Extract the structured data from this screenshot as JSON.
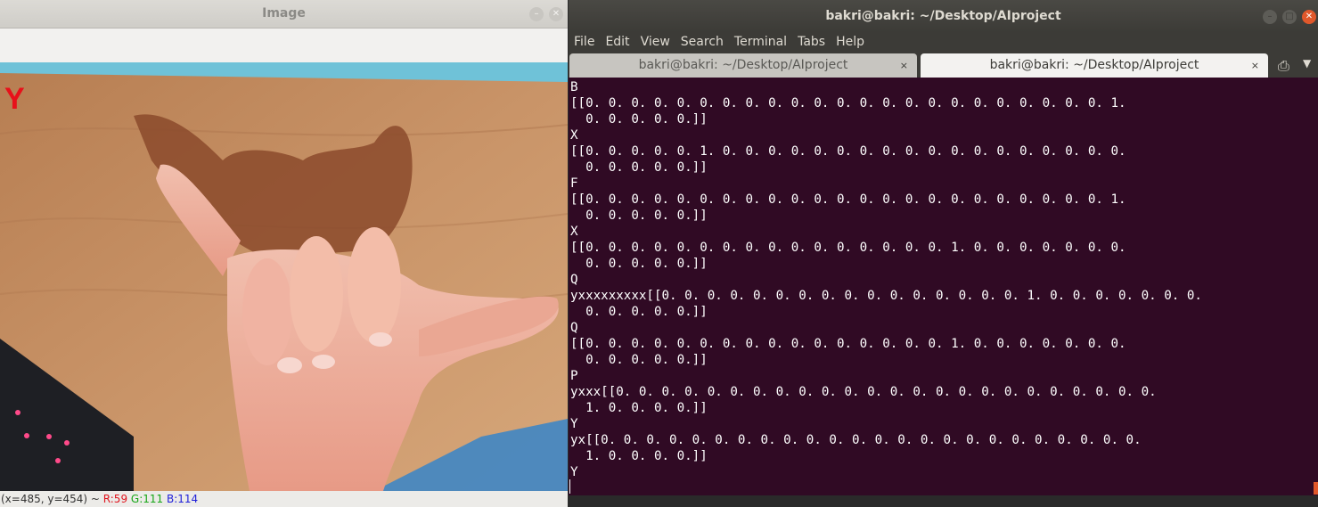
{
  "image_window": {
    "title": "Image",
    "overlay_letter": "Y",
    "status": {
      "coords": "(x=485, y=454) ~ ",
      "r": "R:59",
      "g": "G:111",
      "b": "B:114"
    }
  },
  "terminal_window": {
    "title": "bakri@bakri: ~/Desktop/AIproject",
    "menu": [
      "File",
      "Edit",
      "View",
      "Search",
      "Terminal",
      "Tabs",
      "Help"
    ],
    "tabs": [
      {
        "label": "bakri@bakri: ~/Desktop/AIproject",
        "close": "×"
      },
      {
        "label": "bakri@bakri: ~/Desktop/AIproject",
        "close": "×"
      }
    ],
    "output_lines": [
      "B",
      "[[0. 0. 0. 0. 0. 0. 0. 0. 0. 0. 0. 0. 0. 0. 0. 0. 0. 0. 0. 0. 0. 0. 0. 1.",
      "  0. 0. 0. 0. 0.]]",
      "X",
      "[[0. 0. 0. 0. 0. 1. 0. 0. 0. 0. 0. 0. 0. 0. 0. 0. 0. 0. 0. 0. 0. 0. 0. 0.",
      "  0. 0. 0. 0. 0.]]",
      "F",
      "[[0. 0. 0. 0. 0. 0. 0. 0. 0. 0. 0. 0. 0. 0. 0. 0. 0. 0. 0. 0. 0. 0. 0. 1.",
      "  0. 0. 0. 0. 0.]]",
      "X",
      "[[0. 0. 0. 0. 0. 0. 0. 0. 0. 0. 0. 0. 0. 0. 0. 0. 1. 0. 0. 0. 0. 0. 0. 0.",
      "  0. 0. 0. 0. 0.]]",
      "Q",
      "yxxxxxxxxx[[0. 0. 0. 0. 0. 0. 0. 0. 0. 0. 0. 0. 0. 0. 0. 0. 1. 0. 0. 0. 0. 0. 0. 0.",
      "  0. 0. 0. 0. 0.]]",
      "Q",
      "[[0. 0. 0. 0. 0. 0. 0. 0. 0. 0. 0. 0. 0. 0. 0. 0. 1. 0. 0. 0. 0. 0. 0. 0.",
      "  0. 0. 0. 0. 0.]]",
      "P",
      "yxxx[[0. 0. 0. 0. 0. 0. 0. 0. 0. 0. 0. 0. 0. 0. 0. 0. 0. 0. 0. 0. 0. 0. 0. 0.",
      "  1. 0. 0. 0. 0.]]",
      "Y",
      "yx[[0. 0. 0. 0. 0. 0. 0. 0. 0. 0. 0. 0. 0. 0. 0. 0. 0. 0. 0. 0. 0. 0. 0. 0.",
      "  1. 0. 0. 0. 0.]]",
      "Y"
    ]
  },
  "colors": {
    "terminal_bg": "#300a24",
    "accent_orange": "#e0582b",
    "overlay_red": "#e8101a"
  }
}
